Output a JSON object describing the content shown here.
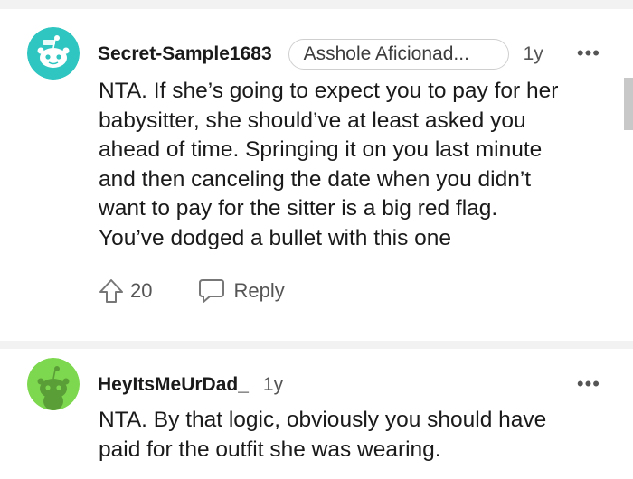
{
  "comments": [
    {
      "username": "Secret-Sample1683",
      "flair": "Asshole Aficionad...",
      "age": "1y",
      "more_label": "•••",
      "body_lines": [
        "NTA. If she’s going to expect you to pay for her",
        "babysitter, she should’ve at least asked you",
        "ahead of time. Springing it on you last minute",
        "and then canceling the date when you didn’t",
        "want to pay for the sitter is a big red flag.",
        "You’ve dodged a bullet with this one"
      ],
      "upvotes": "20",
      "reply_label": "Reply",
      "avatar_icon": "snoo-avatar-icon",
      "avatar_color": "#2fc5c0"
    },
    {
      "username": "HeyItsMeUrDad_",
      "age": "1y",
      "more_label": "•••",
      "body_lines": [
        "NTA. By that logic, obviously you should have",
        "paid for the outfit she was wearing."
      ],
      "avatar_icon": "snoo-avatar-icon",
      "avatar_color": "#7ed84f"
    }
  ]
}
